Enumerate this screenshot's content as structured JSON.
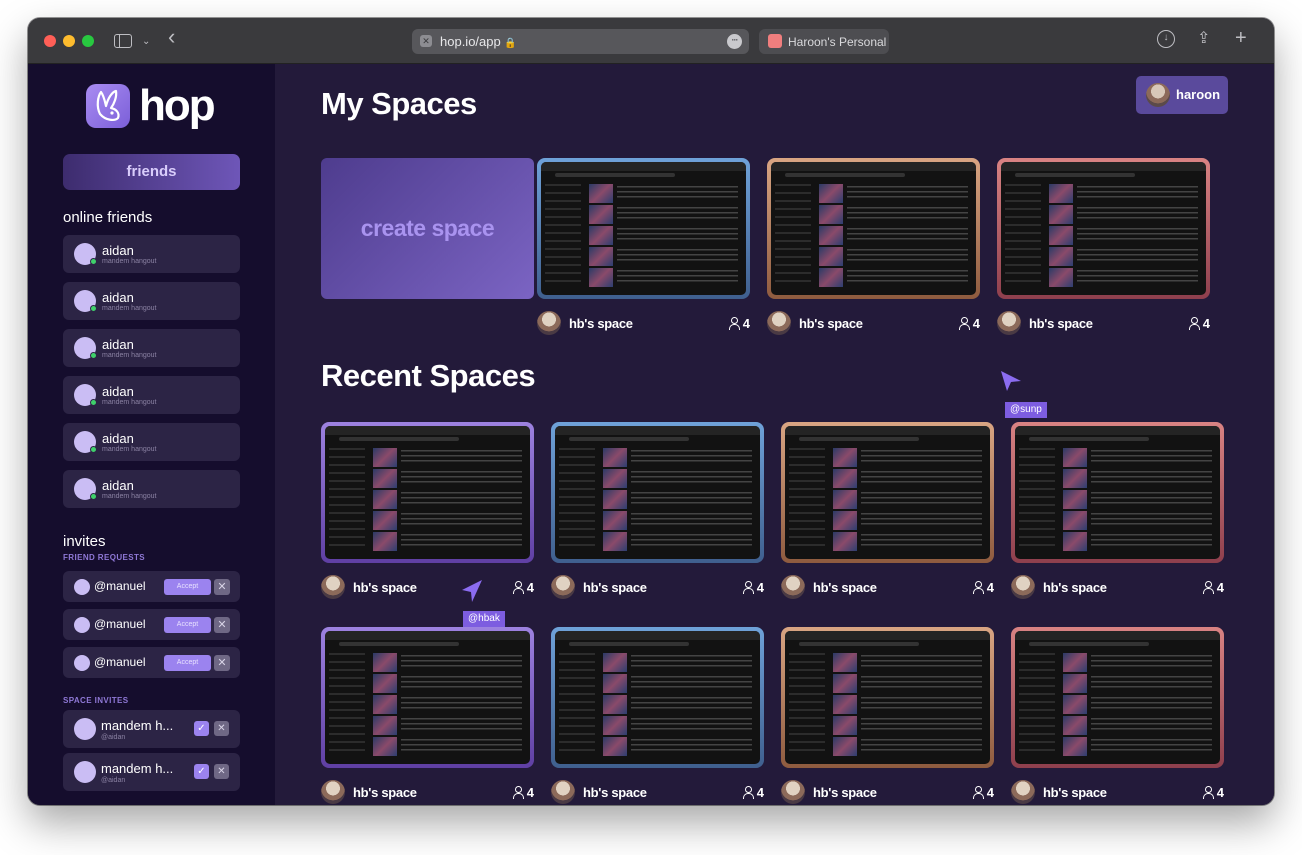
{
  "browser": {
    "url": "hop.io/app",
    "profile_tab": "Haroon's Personal"
  },
  "brand": {
    "name": "hop"
  },
  "sidebar": {
    "friends_button": "friends",
    "online_title": "online friends",
    "online_friends": [
      {
        "name": "aidan",
        "status": "mandem hangout"
      },
      {
        "name": "aidan",
        "status": "mandem hangout"
      },
      {
        "name": "aidan",
        "status": "mandem hangout"
      },
      {
        "name": "aidan",
        "status": "mandem hangout"
      },
      {
        "name": "aidan",
        "status": "mandem hangout"
      },
      {
        "name": "aidan",
        "status": "mandem hangout"
      }
    ],
    "invites_title": "invites",
    "friend_requests_title": "FRIEND REQUESTS",
    "friend_requests": [
      {
        "name": "@manuel",
        "accept": "Accept"
      },
      {
        "name": "@manuel",
        "accept": "Accept"
      },
      {
        "name": "@manuel",
        "accept": "Accept"
      }
    ],
    "space_invites_title": "SPACE INVITES",
    "space_invites": [
      {
        "name": "mandem h...",
        "from": "@aidan"
      },
      {
        "name": "mandem h...",
        "from": "@aidan"
      }
    ]
  },
  "header": {
    "user": "haroon"
  },
  "my_spaces": {
    "title": "My Spaces",
    "create_label": "create space",
    "spaces": [
      {
        "name": "hb's space",
        "count": "4",
        "frame": "blue"
      },
      {
        "name": "hb's space",
        "count": "4",
        "frame": "orange"
      },
      {
        "name": "hb's space",
        "count": "4",
        "frame": "red"
      }
    ]
  },
  "recent_spaces": {
    "title": "Recent Spaces",
    "spaces": [
      {
        "name": "hb's space",
        "count": "4",
        "frame": "purple"
      },
      {
        "name": "hb's space",
        "count": "4",
        "frame": "blue"
      },
      {
        "name": "hb's space",
        "count": "4",
        "frame": "orange"
      },
      {
        "name": "hb's space",
        "count": "4",
        "frame": "red"
      },
      {
        "name": "hb's space",
        "count": "4",
        "frame": "purple"
      },
      {
        "name": "hb's space",
        "count": "4",
        "frame": "blue"
      },
      {
        "name": "hb's space",
        "count": "4",
        "frame": "orange"
      },
      {
        "name": "hb's space",
        "count": "4",
        "frame": "red"
      }
    ]
  },
  "cursors": [
    {
      "label": "@sunp"
    },
    {
      "label": "@hbak"
    }
  ],
  "colors": {
    "sidebar_bg": "#150d2d",
    "main_bg": "#231a3a",
    "accent": "#9b83ef",
    "online": "#3fd16b"
  }
}
